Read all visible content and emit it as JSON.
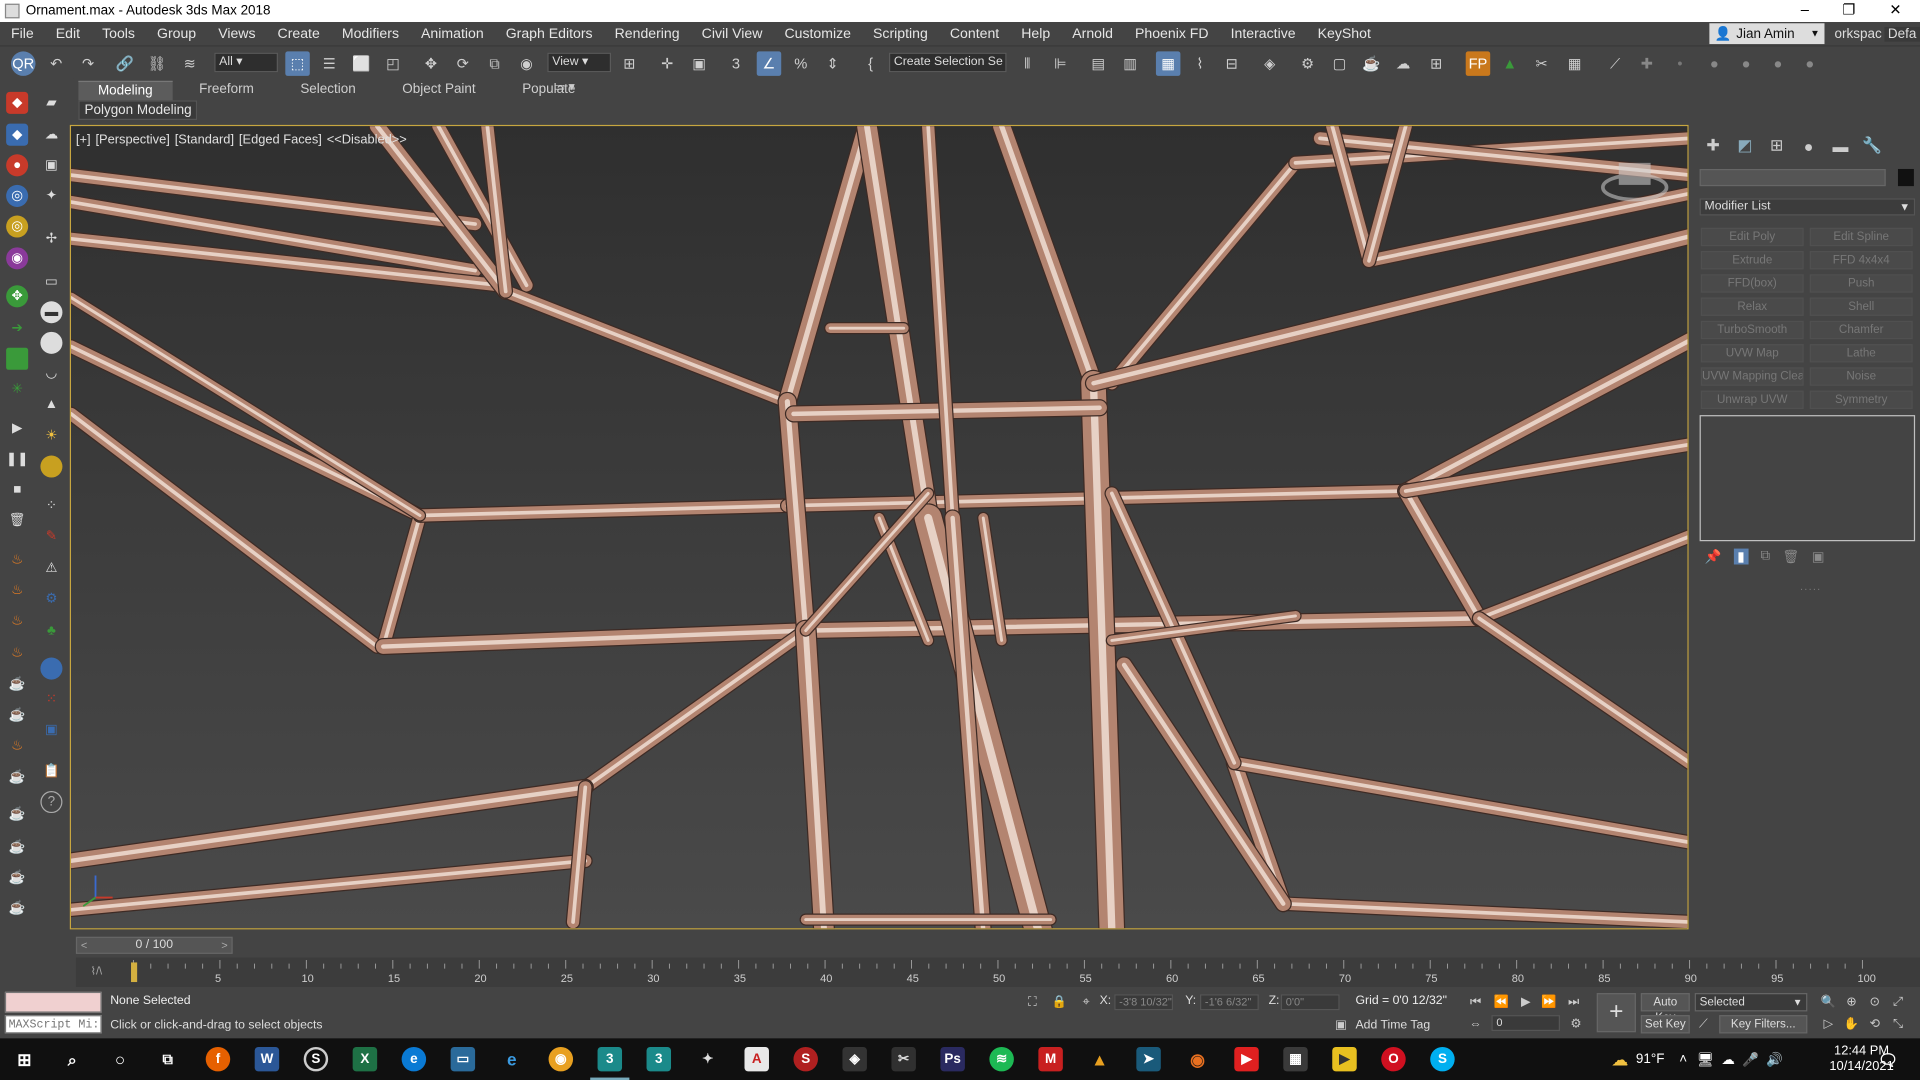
{
  "app": {
    "title": "Ornament.max - Autodesk 3ds Max 2018",
    "user": "Jian Amin",
    "workspace_short": "orkspac",
    "workspace": "Defa"
  },
  "menu": [
    "File",
    "Edit",
    "Tools",
    "Group",
    "Views",
    "Create",
    "Modifiers",
    "Animation",
    "Graph Editors",
    "Rendering",
    "Civil View",
    "Customize",
    "Scripting",
    "Content",
    "Help",
    "Arnold",
    "Phoenix FD",
    "Interactive",
    "KeyShot"
  ],
  "toolbar": {
    "filter_value": "All",
    "refcoord_value": "View",
    "selection_set_value": "Create Selection Se"
  },
  "ribbon": {
    "tabs": [
      "Modeling",
      "Freeform",
      "Selection",
      "Object Paint",
      "Populate"
    ],
    "subtab": "Polygon Modeling"
  },
  "viewport": {
    "labels": [
      "[+]",
      "[Perspective]",
      "[Standard]",
      "[Edged Faces]",
      "<<Disabled>>"
    ]
  },
  "command_panel": {
    "modifier_list_label": "Modifier List",
    "modifiers": [
      "Edit Poly",
      "Edit Spline",
      "Extrude",
      "FFD 4x4x4",
      "FFD(box)",
      "Push",
      "Relax",
      "Shell",
      "TurboSmooth",
      "Chamfer",
      "UVW Map",
      "Lathe",
      "UVW Mapping Clear",
      "Noise",
      "Unwrap UVW",
      "Symmetry"
    ]
  },
  "timeline": {
    "frame_display": "0 / 100",
    "ticks": [
      "5",
      "10",
      "15",
      "20",
      "25",
      "30",
      "35",
      "40",
      "45",
      "50",
      "55",
      "60",
      "65",
      "70",
      "75",
      "80",
      "85",
      "90",
      "95",
      "100"
    ]
  },
  "status": {
    "maxscript": "MAXScript Mi:",
    "selection": "None Selected",
    "prompt": "Click or click-and-drag to select objects",
    "x_label": "X:",
    "x_value": "-3'8 10/32\"",
    "y_label": "Y:",
    "y_value": "-1'6 6/32\"",
    "z_label": "Z:",
    "z_value": "0'0\"",
    "grid": "Grid = 0'0 12/32\"",
    "add_time_tag": "Add Time Tag",
    "auto_key": "Auto Key",
    "set_key": "Set Key",
    "selected_value": "Selected",
    "key_filters": "Key Filters...",
    "current_frame": "0"
  },
  "taskbar": {
    "temperature": "91°F",
    "time": "12:44 PM",
    "date": "10/14/2021"
  },
  "colors": {
    "viewport_bg": "#3a3a3a",
    "strut": "#b38470",
    "strut_highlight": "#f1dfd4",
    "active_blue": "#5a7fae",
    "viewport_border": "#c7a640"
  }
}
